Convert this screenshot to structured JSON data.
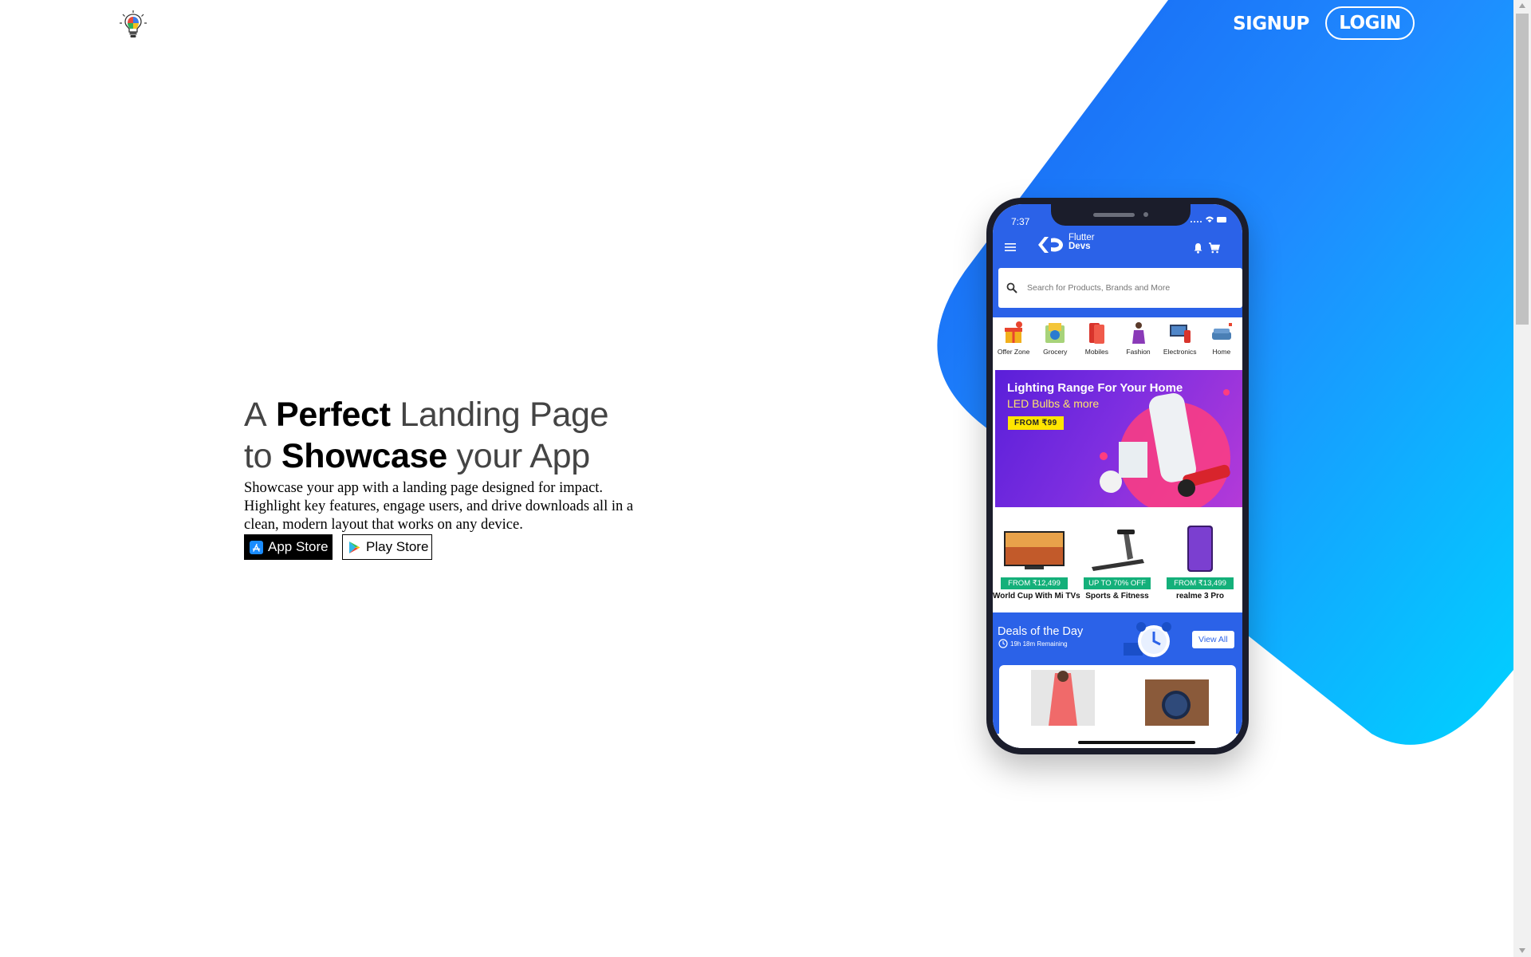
{
  "nav": {
    "logo_icon": "lightbulb-icon",
    "signup_label": "SIGNUP",
    "login_label": "LOGIN"
  },
  "hero": {
    "title_line1": {
      "a": "A",
      "bold": "Perfect",
      "rest": "Landing Page"
    },
    "title_line2": {
      "a": "to",
      "bold": "Showcase",
      "rest": "your App"
    },
    "description": "Showcase your app with a landing page designed for impact. Highlight key features, engage users, and drive downloads all in a clean, modern layout that works on any device.",
    "appstore_label": "App Store",
    "playstore_label": "Play Store"
  },
  "phone": {
    "status_time": "7:37",
    "brand_line1": "Flutter",
    "brand_line2": "Devs",
    "search_placeholder": "Search for Products, Brands and More",
    "categories": [
      {
        "label": "Offer Zone",
        "color": "#f2b01c"
      },
      {
        "label": "Grocery",
        "color": "#5aa34a"
      },
      {
        "label": "Mobiles",
        "color": "#e2443a"
      },
      {
        "label": "Fashion",
        "color": "#8a3ab8"
      },
      {
        "label": "Electronics",
        "color": "#2b3f63"
      },
      {
        "label": "Home",
        "color": "#4a7fb5"
      }
    ],
    "banner": {
      "title": "Lighting Range For Your Home",
      "subtitle": "LED Bulbs & more",
      "badge": "FROM ₹99"
    },
    "promos": [
      {
        "tag": "FROM ₹12,499",
        "name": "World Cup With Mi TVs"
      },
      {
        "tag": "UP TO 70% OFF",
        "name": "Sports & Fitness"
      },
      {
        "tag": "FROM ₹13,499",
        "name": "realme 3 Pro"
      }
    ],
    "deals": {
      "title": "Deals of the Day",
      "remaining": "19h 18m Remaining",
      "view_all": "View All"
    }
  },
  "colors": {
    "accent_blue": "#1f7bff",
    "accent_cyan": "#00c8ff",
    "app_blue": "#2b62e8"
  }
}
